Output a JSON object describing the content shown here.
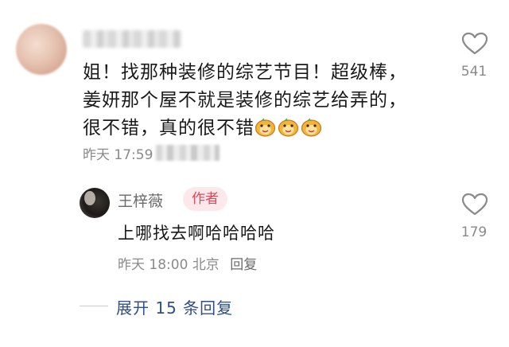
{
  "comment": {
    "lines": [
      "姐！找那种装修的综艺节目！超级棒，",
      "姜妍那个屋不就是装修的综艺给弄的，",
      "很不错，真的很不错"
    ],
    "emoji_icon": "dog-face-sticker-icon",
    "time": "昨天 17:59",
    "like_count": "541"
  },
  "reply": {
    "author": "王梓薇",
    "badge": "作者",
    "text": "上哪找去啊哈哈哈哈",
    "time": "昨天 18:00",
    "location": "北京",
    "reply_label": "回复",
    "like_count": "179"
  },
  "expand_label": "展开 15 条回复",
  "colors": {
    "text": "#1a1a1a",
    "meta": "#8a8a8a",
    "badge_bg": "#fde9ec",
    "badge_text": "#e8445a",
    "link": "#2f4f8a"
  }
}
